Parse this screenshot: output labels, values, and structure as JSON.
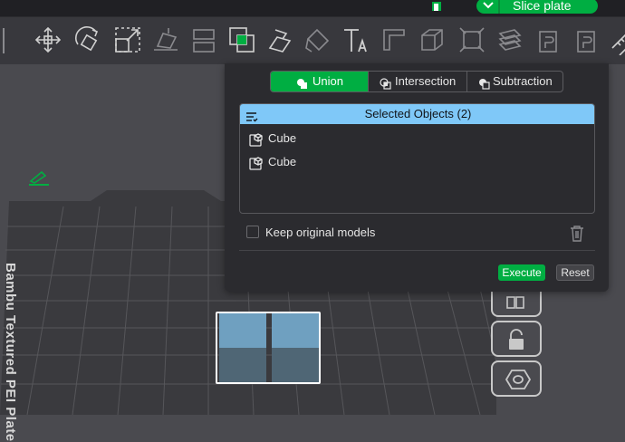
{
  "header": {
    "slice_label": "Slice plate"
  },
  "toolbar": {
    "icons": [
      "move-icon",
      "rotate-icon",
      "scale-icon",
      "place-on-face-icon",
      "cut-icon",
      "boolean-icon",
      "support-paint-icon",
      "seam-paint-icon",
      "color-paint-icon",
      "text-icon",
      "measure-icon",
      "assembly-icon",
      "arrange-icon",
      "orient-icon",
      "layers-icon",
      "add-cube-icon",
      "add-plate-icon",
      "variable-height-icon"
    ]
  },
  "viewport": {
    "plate_label": "Bambu Textured PEI Plate"
  },
  "boolean_panel": {
    "tabs": [
      {
        "label": "Union",
        "active": true
      },
      {
        "label": "Intersection",
        "active": false
      },
      {
        "label": "Subtraction",
        "active": false
      }
    ],
    "selected_header": "Selected Objects",
    "selected_count": "(2)",
    "objects": [
      "Cube",
      "Cube"
    ],
    "keep_original_label": "Keep original models",
    "execute_label": "Execute",
    "reset_label": "Reset"
  },
  "colors": {
    "accent": "#00ae42",
    "header_blue": "#7fc8f8",
    "panel_bg": "#2b2b2f"
  }
}
